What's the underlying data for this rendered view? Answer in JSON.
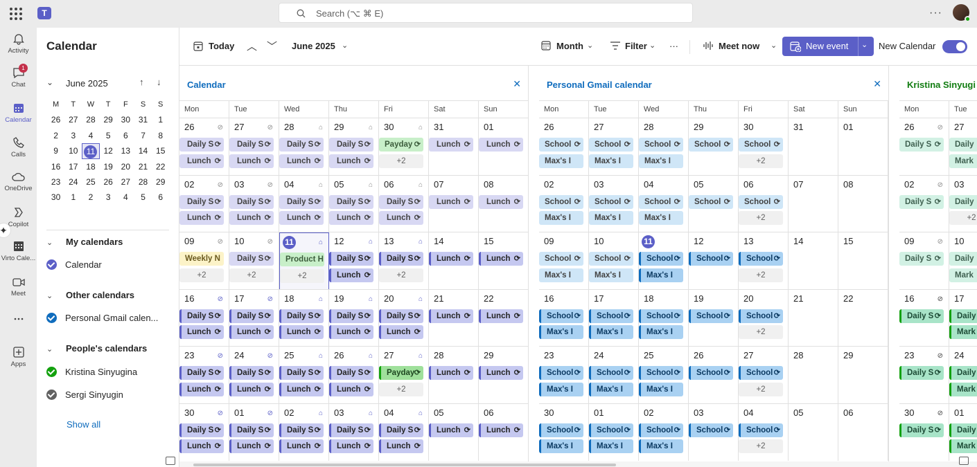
{
  "app": {
    "search_placeholder": "Search (⌥ ⌘ E)"
  },
  "rail": [
    {
      "label": "Activity",
      "icon": "bell-icon"
    },
    {
      "label": "Chat",
      "icon": "chat-icon",
      "badge": "1"
    },
    {
      "label": "Calendar",
      "icon": "calendar-icon",
      "active": true
    },
    {
      "label": "Calls",
      "icon": "phone-icon"
    },
    {
      "label": "OneDrive",
      "icon": "cloud-icon"
    },
    {
      "label": "Copilot",
      "icon": "copilot-icon"
    },
    {
      "label": "Virto Cale...",
      "icon": "virto-calendar-icon"
    },
    {
      "label": "Meet",
      "icon": "video-icon"
    },
    {
      "label": "...",
      "icon": "more-icon"
    },
    {
      "label": "Apps",
      "icon": "add-apps-icon"
    }
  ],
  "sidebar": {
    "title": "Calendar",
    "mini_month": "June 2025",
    "weekdays": [
      "M",
      "T",
      "W",
      "T",
      "F",
      "S",
      "S"
    ],
    "days": [
      "26",
      "27",
      "28",
      "29",
      "30",
      "31",
      "1",
      "2",
      "3",
      "4",
      "5",
      "6",
      "7",
      "8",
      "9",
      "10",
      "11",
      "12",
      "13",
      "14",
      "15",
      "16",
      "17",
      "18",
      "19",
      "20",
      "21",
      "22",
      "23",
      "24",
      "25",
      "26",
      "27",
      "28",
      "29",
      "30",
      "1",
      "2",
      "3",
      "4",
      "5",
      "6"
    ],
    "selected_day": "11",
    "sections": [
      {
        "title": "My calendars",
        "items": [
          {
            "name": "Calendar",
            "color": "#5b5fc7"
          }
        ]
      },
      {
        "title": "Other calendars",
        "items": [
          {
            "name": "Personal Gmail calen...",
            "color": "#0f6cbd"
          }
        ]
      },
      {
        "title": "People's calendars",
        "items": [
          {
            "name": "Kristina Sinyugina",
            "color": "#13a10e"
          },
          {
            "name": "Sergi Sinyugin",
            "color": "#616161"
          }
        ]
      }
    ],
    "show_all": "Show all"
  },
  "toolbar": {
    "today": "Today",
    "month_label": "June 2025",
    "view": "Month",
    "filter": "Filter",
    "more": "···",
    "meet_now": "Meet now",
    "new_event": "New event",
    "new_calendar": "New Calendar",
    "new_calendar_on": true
  },
  "dow": [
    "Mon",
    "Tue",
    "Wed",
    "Thu",
    "Fri",
    "Sat",
    "Sun"
  ],
  "panels": [
    {
      "title": "Calendar",
      "weeks": [
        [
          "26",
          "27",
          "28",
          "29",
          "30",
          "31",
          "01"
        ],
        [
          "02",
          "03",
          "04",
          "05",
          "06",
          "07",
          "08"
        ],
        [
          "09",
          "10",
          "11",
          "12",
          "13",
          "14",
          "15"
        ],
        [
          "16",
          "17",
          "18",
          "19",
          "20",
          "21",
          "22"
        ],
        [
          "23",
          "24",
          "25",
          "26",
          "27",
          "28",
          "29"
        ],
        [
          "30",
          "01",
          "02",
          "03",
          "04",
          "05",
          "06"
        ]
      ],
      "events": [
        [
          [
            "Daily S",
            "Lunch"
          ],
          [
            "Daily S",
            "Lunch"
          ],
          [
            "Daily S",
            "Lunch"
          ],
          [
            "Daily S",
            "Lunch"
          ],
          [
            "Payday",
            "+2"
          ],
          [
            "Lunch"
          ],
          [
            "Lunch"
          ]
        ],
        [
          [
            "Daily S",
            "Lunch"
          ],
          [
            "Daily S",
            "Lunch"
          ],
          [
            "Daily S",
            "Lunch"
          ],
          [
            "Daily S",
            "Lunch"
          ],
          [
            "Daily S",
            "Lunch"
          ],
          [
            "Lunch"
          ],
          [
            "Lunch"
          ]
        ],
        [
          [
            "Weekly N",
            "+2"
          ],
          [
            "Daily S",
            "+2"
          ],
          [
            "Product H",
            "+2"
          ],
          [
            "Daily S",
            "Lunch"
          ],
          [
            "Daily S",
            "+2"
          ],
          [
            "Lunch"
          ],
          [
            "Lunch"
          ]
        ],
        [
          [
            "Daily S",
            "Lunch"
          ],
          [
            "Daily S",
            "Lunch"
          ],
          [
            "Daily S",
            "Lunch"
          ],
          [
            "Daily S",
            "Lunch"
          ],
          [
            "Daily S",
            "Lunch"
          ],
          [
            "Lunch"
          ],
          [
            "Lunch"
          ]
        ],
        [
          [
            "Daily S",
            "Lunch"
          ],
          [
            "Daily S",
            "Lunch"
          ],
          [
            "Daily S",
            "Lunch"
          ],
          [
            "Daily S",
            "Lunch"
          ],
          [
            "Payday",
            "+2"
          ],
          [
            "Lunch"
          ],
          [
            "Lunch"
          ]
        ],
        [
          [
            "Daily S",
            "Lunch"
          ],
          [
            "Daily S",
            "Lunch"
          ],
          [
            "Daily S",
            "Lunch"
          ],
          [
            "Daily S",
            "Lunch"
          ],
          [
            "Daily S",
            "Lunch"
          ],
          [
            "Lunch"
          ],
          [
            "Lunch"
          ]
        ]
      ]
    },
    {
      "title": "Personal Gmail calendar",
      "weeks": [
        [
          "26",
          "27",
          "28",
          "29",
          "30",
          "31",
          "01"
        ],
        [
          "02",
          "03",
          "04",
          "05",
          "06",
          "07",
          "08"
        ],
        [
          "09",
          "10",
          "11",
          "12",
          "13",
          "14",
          "15"
        ],
        [
          "16",
          "17",
          "18",
          "19",
          "20",
          "21",
          "22"
        ],
        [
          "23",
          "24",
          "25",
          "26",
          "27",
          "28",
          "29"
        ],
        [
          "30",
          "01",
          "02",
          "03",
          "04",
          "05",
          "06"
        ]
      ],
      "events": [
        [
          [
            "School",
            "Max's I"
          ],
          [
            "School",
            "Max's I"
          ],
          [
            "School",
            "Max's I"
          ],
          [
            "School"
          ],
          [
            "School",
            "+2"
          ],
          [],
          []
        ],
        [
          [
            "School",
            "Max's I"
          ],
          [
            "School",
            "Max's I"
          ],
          [
            "School",
            "Max's I"
          ],
          [
            "School"
          ],
          [
            "School",
            "+2"
          ],
          [],
          []
        ],
        [
          [
            "School",
            "Max's I"
          ],
          [
            "School",
            "Max's I"
          ],
          [
            "School",
            "Max's I"
          ],
          [
            "School"
          ],
          [
            "School",
            "+2"
          ],
          [],
          []
        ],
        [
          [
            "School",
            "Max's I"
          ],
          [
            "School",
            "Max's I"
          ],
          [
            "School",
            "Max's I"
          ],
          [
            "School"
          ],
          [
            "School",
            "+2"
          ],
          [],
          []
        ],
        [
          [
            "School",
            "Max's I"
          ],
          [
            "School",
            "Max's I"
          ],
          [
            "School",
            "Max's I"
          ],
          [
            "School"
          ],
          [
            "School",
            "+2"
          ],
          [],
          []
        ],
        [
          [
            "School",
            "Max's I"
          ],
          [
            "School",
            "Max's I"
          ],
          [
            "School",
            "Max's I"
          ],
          [
            "School"
          ],
          [
            "School",
            "+2"
          ],
          [],
          []
        ]
      ]
    },
    {
      "title": "Kristina Sinyugi",
      "weeks": [
        [
          "26",
          "27"
        ],
        [
          "02",
          "03"
        ],
        [
          "09",
          "10"
        ],
        [
          "16",
          "17"
        ],
        [
          "23",
          "24"
        ],
        [
          "30",
          "01"
        ]
      ],
      "events": [
        [
          [
            "Daily S"
          ],
          [
            "Daily",
            "Mark"
          ]
        ],
        [
          [
            "Daily S"
          ],
          [
            "Daily",
            "+2"
          ]
        ],
        [
          [
            "Daily S"
          ],
          [
            "Daily",
            "Mark"
          ]
        ],
        [
          [
            "Daily S"
          ],
          [
            "Daily",
            "Mark"
          ]
        ],
        [
          [
            "Daily S"
          ],
          [
            "Daily",
            "Mark"
          ]
        ],
        [
          [
            "Daily S"
          ],
          [
            "Daily",
            "Mark"
          ]
        ]
      ]
    }
  ]
}
